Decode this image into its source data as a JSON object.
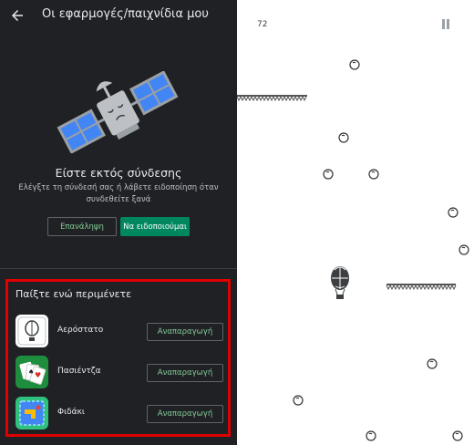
{
  "appbar": {
    "title": "Οι εφαρμογές/παιχνίδια μου"
  },
  "offline": {
    "title": "Είστε εκτός σύνδεσης",
    "message": "Ελέγξτε τη σύνδεσή σας ή λάβετε ειδοποίηση όταν συνδεθείτε ξανά",
    "retry_label": "Επανάληψη",
    "notify_label": "Να ειδοποιούμαι"
  },
  "games_section": {
    "header": "Παίξτε ενώ περιμένετε",
    "items": [
      {
        "name": "Αερόστατο",
        "action": "Αναπαραγωγή",
        "icon": "balloon-icon"
      },
      {
        "name": "Πασιέντζα",
        "action": "Αναπαραγωγή",
        "icon": "solitaire-icon"
      },
      {
        "name": "Φιδάκι",
        "action": "Αναπαραγωγή",
        "icon": "snake-icon"
      }
    ]
  },
  "game": {
    "score": "72",
    "pause_icon": "pause-icon"
  },
  "colors": {
    "dark_bg": "#202124",
    "accent": "#01875f",
    "highlight_border": "#e00000"
  }
}
